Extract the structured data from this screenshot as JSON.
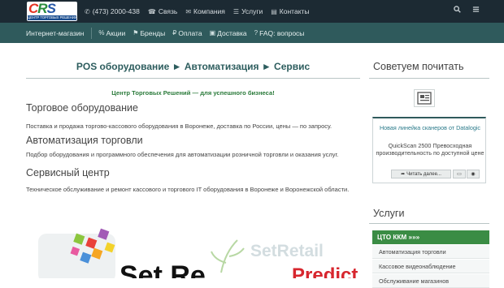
{
  "header": {
    "logo_text": "CRS",
    "logo_subtitle": "ЦЕНТР ТОРГОВЫХ РЕШЕНИЙ",
    "phone": "(473) 2000-438",
    "links": [
      {
        "label": "Связь",
        "icon": "phone-icon"
      },
      {
        "label": "Компания",
        "icon": "envelope-icon"
      },
      {
        "label": "Услуги",
        "icon": "list-icon"
      },
      {
        "label": "Контакты",
        "icon": "contact-card-icon"
      }
    ]
  },
  "subnav": {
    "items": [
      {
        "label": "Интернет-магазин",
        "icon": ""
      },
      {
        "label": "Акции",
        "icon": "percent-icon"
      },
      {
        "label": "Бренды",
        "icon": "tag-icon"
      },
      {
        "label": "Оплата",
        "icon": "ruble-icon"
      },
      {
        "label": "Доставка",
        "icon": "truck-icon"
      },
      {
        "label": "FAQ: вопросы",
        "icon": "question-icon"
      }
    ]
  },
  "main": {
    "breadcrumb": "POS оборудование ► Автоматизация ► Сервис",
    "slogan": "Центр Торговых Решений — для успешного бизнеса!",
    "sections": [
      {
        "title": "Торговое оборудование",
        "text": "Поставка и продажа торгово-кассового оборудования в Воронеже, доставка по России, цены — по запросу."
      },
      {
        "title": "Автоматизация торговли",
        "text": "Подбор оборудования и программного обеспечения для автоматизации розничной торговли и оказания услуг."
      },
      {
        "title": "Сервисный центр",
        "text": "Техническое обслуживание и ремонт кассового и торгового IT оборудования в Воронеже и Воронежской области."
      }
    ],
    "banner": {
      "setretail": "SetRetail",
      "predict": "Predict"
    }
  },
  "sidebar": {
    "recommend_title": "Советуем почитать",
    "card": {
      "title": "Новая линейка сканеров от Datalogic",
      "text": "QuickScan 2500 Превосходная производительность по доступной цене",
      "read_more": "Читать далее..."
    },
    "services_title": "Услуги",
    "services": [
      {
        "label": "ЦТО ККМ »»»",
        "active": true
      },
      {
        "label": "Автоматизация торговли",
        "active": false
      },
      {
        "label": "Кассовое видеонаблюдение",
        "active": false
      },
      {
        "label": "Обслуживание магазинов",
        "active": false
      }
    ]
  },
  "colors": {
    "topbar": "#1c2a33",
    "subbar": "#2f5a5c",
    "accent_green": "#3a8c44",
    "heading_teal": "#2d5d5e"
  }
}
